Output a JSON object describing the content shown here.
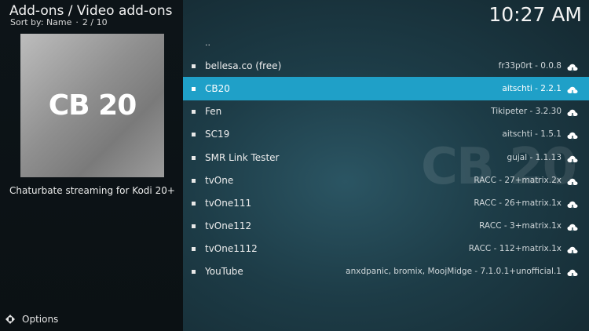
{
  "header": {
    "title": "Add-ons / Video add-ons",
    "sort_label": "Sort by: Name",
    "separator": "·",
    "position": "2 / 10"
  },
  "clock": "10:27 AM",
  "preview": {
    "thumb_text": "CB 20",
    "description": "Chaturbate streaming for Kodi 20+",
    "watermark_text": "CB 20"
  },
  "list": {
    "parent": "..",
    "items": [
      {
        "name": "bellesa.co (free)",
        "meta": "fr33p0rt - 0.0.8"
      },
      {
        "name": "CB20",
        "meta": "aitschti - 2.2.1"
      },
      {
        "name": "Fen",
        "meta": "Tikipeter - 3.2.30"
      },
      {
        "name": "SC19",
        "meta": "aitschti - 1.5.1"
      },
      {
        "name": "SMR Link Tester",
        "meta": "gujal - 1.1.13"
      },
      {
        "name": "tvOne",
        "meta": "RACC - 27+matrix.2x"
      },
      {
        "name": "tvOne111",
        "meta": "RACC - 26+matrix.1x"
      },
      {
        "name": "tvOne112",
        "meta": "RACC - 3+matrix.1x"
      },
      {
        "name": "tvOne1112",
        "meta": "RACC - 112+matrix.1x"
      },
      {
        "name": "YouTube",
        "meta": "anxdpanic, bromix, MoojMidge - 7.1.0.1+unofficial.1"
      }
    ],
    "selected_index": 1
  },
  "footer": {
    "options_label": "Options"
  },
  "icons": {
    "item_status": "cloud-download-icon",
    "options": "options-arrows-icon"
  },
  "colors": {
    "accent": "#1fa0c8",
    "left_panel": "#0d1418",
    "right_panel": "#1d3c47"
  }
}
